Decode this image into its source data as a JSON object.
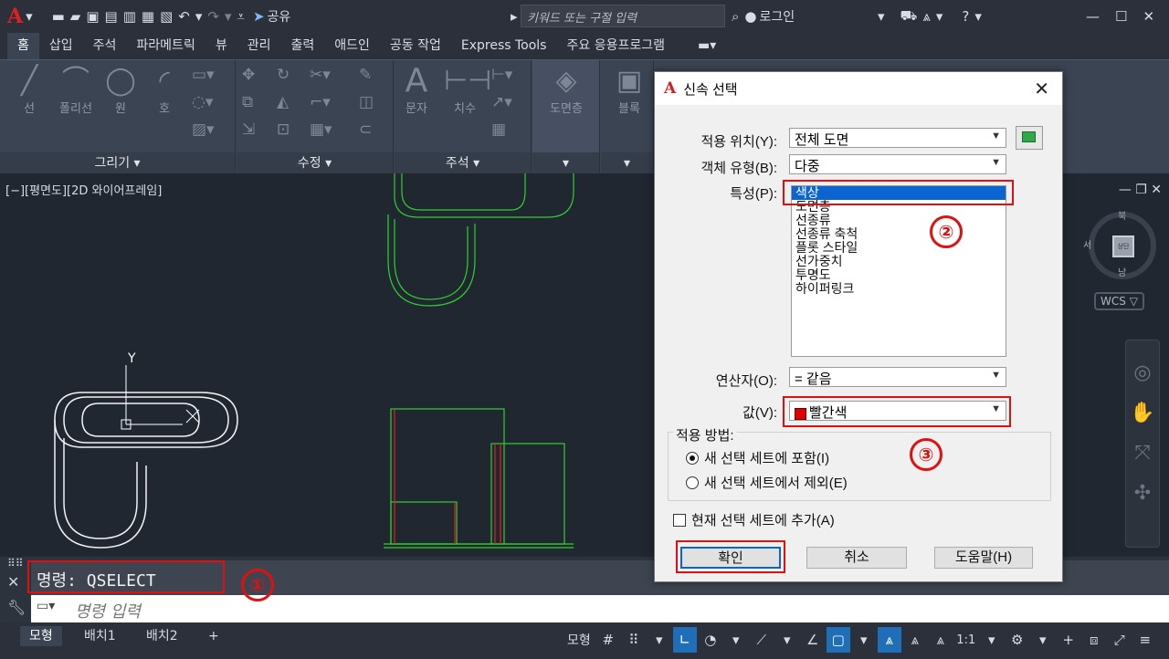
{
  "titlebar": {
    "share": "공유",
    "search_placeholder": "키워드 또는 구절 입력",
    "login": "로그인"
  },
  "tabs": [
    "홈",
    "삽입",
    "주석",
    "파라메트릭",
    "뷰",
    "관리",
    "출력",
    "애드인",
    "공동 작업",
    "Express Tools",
    "주요 응용프로그램"
  ],
  "ribbon": {
    "draw": {
      "label": "그리기 ▾",
      "tools": [
        "선",
        "폴리선",
        "원",
        "호"
      ]
    },
    "modify": {
      "label": "수정 ▾"
    },
    "annotation": {
      "label": "주석 ▾",
      "tools": [
        "문자",
        "치수"
      ]
    },
    "layers": {
      "tool": "도면층"
    },
    "block": {
      "tool": "블록"
    }
  },
  "viewport": {
    "label": "[−][평면도][2D 와이어프레임]",
    "axis_y": "Y",
    "compass": {
      "n": "북",
      "s": "남",
      "w": "서",
      "center": "상단"
    },
    "wcs": "WCS ▽"
  },
  "command": {
    "history": "명령:  QSELECT",
    "input_placeholder": "명령 입력"
  },
  "layout_tabs": [
    "모형",
    "배치1",
    "배치2",
    "+"
  ],
  "status": {
    "model": "모형",
    "scale": "1:1"
  },
  "dialog": {
    "title": "신속 선택",
    "apply_to_label": "적용 위치(Y):",
    "apply_to_value": "전체 도면",
    "object_type_label": "객체 유형(B):",
    "object_type_value": "다중",
    "properties_label": "특성(P):",
    "properties": [
      "색상",
      "도면층",
      "선종류",
      "선종류 축척",
      "플롯 스타일",
      "선가중치",
      "투명도",
      "하이퍼링크"
    ],
    "operator_label": "연산자(O):",
    "operator_value": "= 같음",
    "value_label": "값(V):",
    "value_value": "빨간색",
    "value_swatch": "#e00000",
    "how_label": "적용 방법:",
    "radio_include": "새 선택 세트에 포함(I)",
    "radio_exclude": "새 선택 세트에서 제외(E)",
    "append_label": "현재 선택 세트에 추가(A)",
    "ok": "확인",
    "cancel": "취소",
    "help": "도움말(H)",
    "close": "✕"
  },
  "annotations": [
    "①",
    "②",
    "③"
  ]
}
